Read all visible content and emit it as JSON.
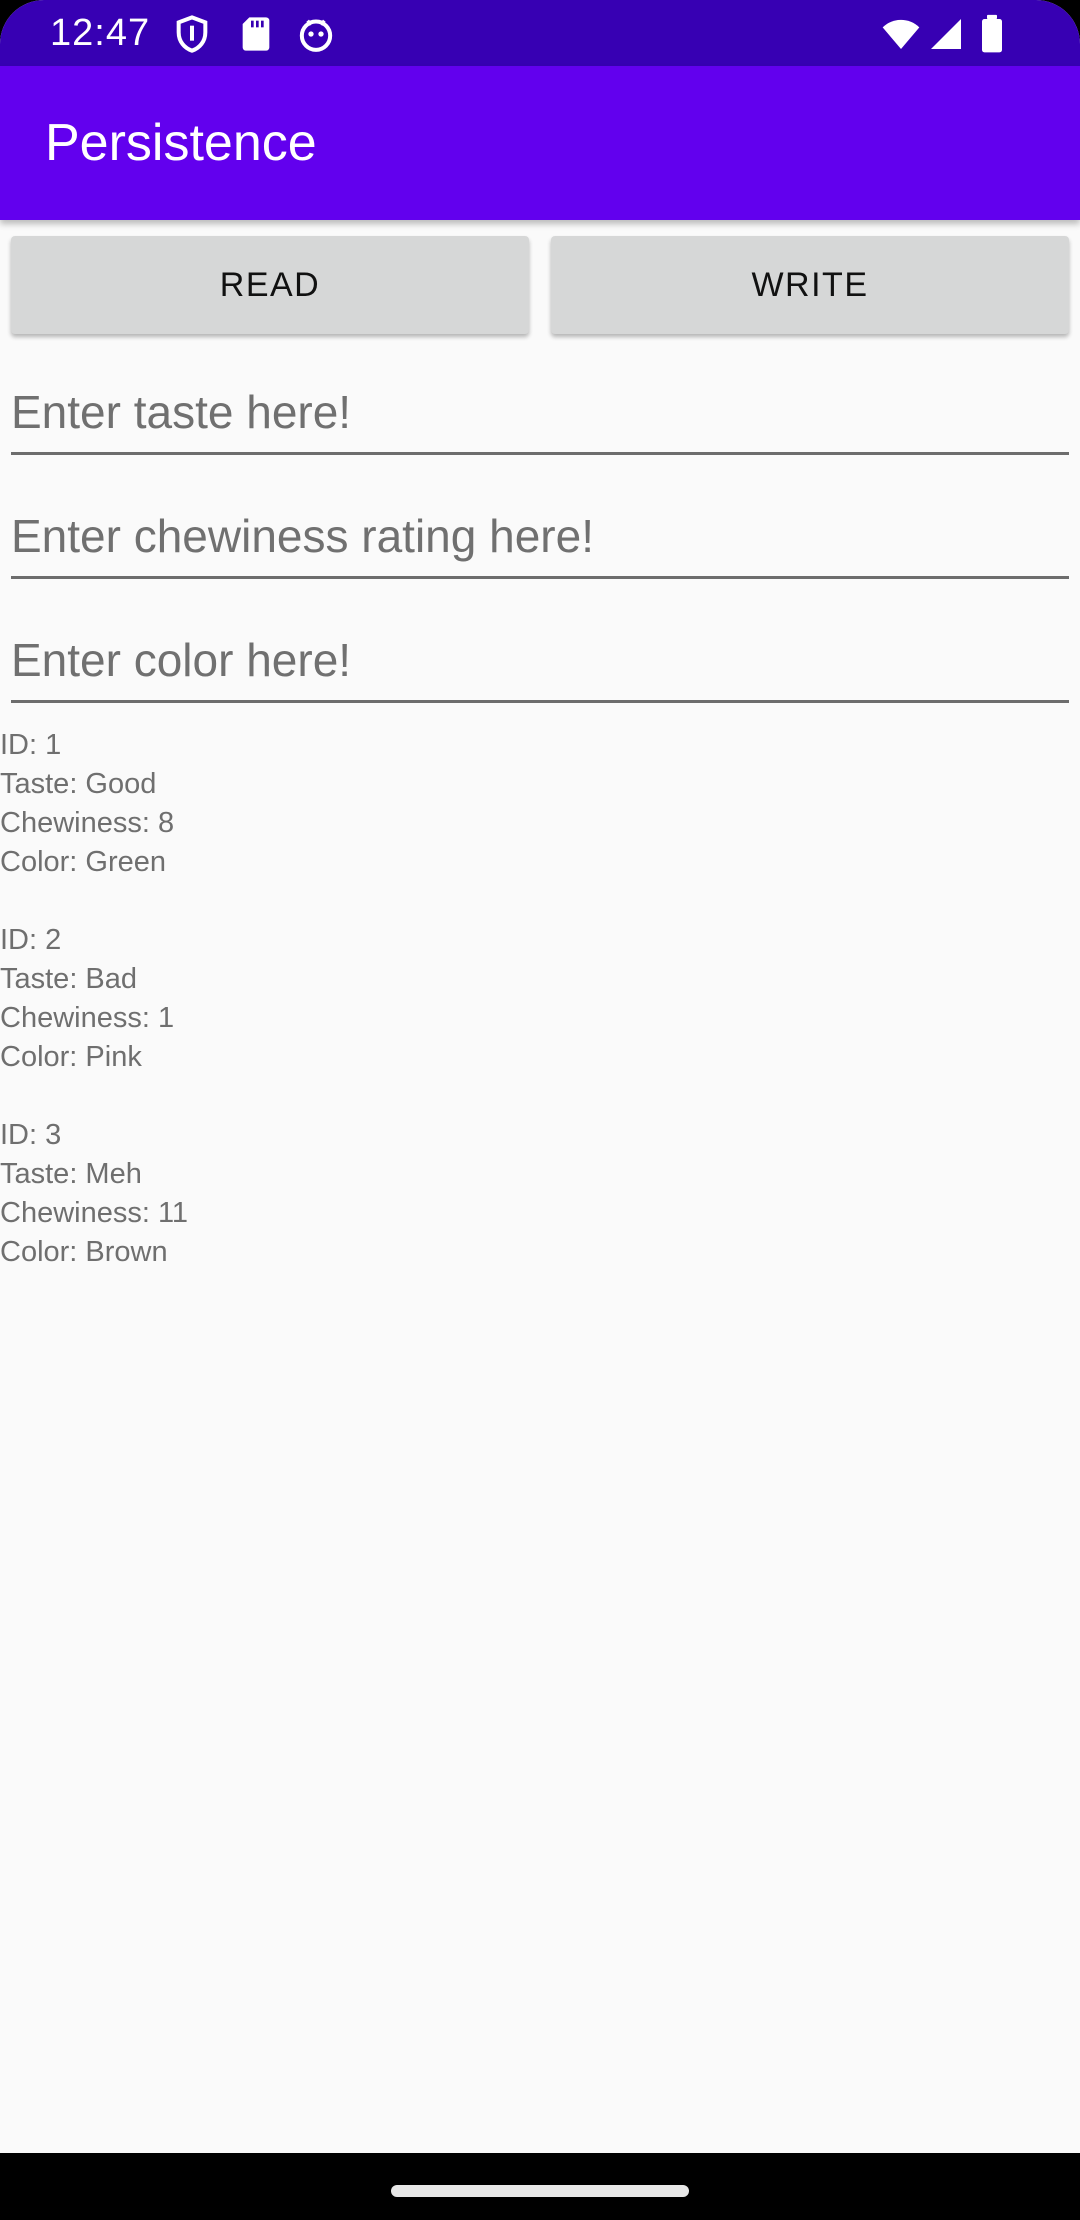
{
  "status_bar": {
    "time": "12:47",
    "left_icons": [
      "shield-icon",
      "sd-card-icon",
      "android-debug-icon"
    ],
    "right_icons": [
      "wifi-icon",
      "cell-signal-icon",
      "battery-icon"
    ]
  },
  "app_bar": {
    "title": "Persistence"
  },
  "buttons": {
    "read_label": "READ",
    "write_label": "WRITE"
  },
  "fields": {
    "taste": {
      "placeholder": "Enter taste here!",
      "value": ""
    },
    "chewiness": {
      "placeholder": "Enter chewiness rating here!",
      "value": ""
    },
    "color": {
      "placeholder": "Enter color here!",
      "value": ""
    }
  },
  "records": [
    {
      "id": "ID: 1",
      "taste": "Taste: Good",
      "chewiness": "Chewiness: 8",
      "color": "Color: Green"
    },
    {
      "id": "ID: 2",
      "taste": "Taste: Bad",
      "chewiness": "Chewiness: 1",
      "color": "Color: Pink"
    },
    {
      "id": "ID: 3",
      "taste": "Taste: Meh",
      "chewiness": "Chewiness: 11",
      "color": "Color: Brown"
    }
  ],
  "colors": {
    "status_bar": "#3700b3",
    "app_bar": "#6200ee",
    "button": "#d6d7d7",
    "background": "#fafafa"
  }
}
